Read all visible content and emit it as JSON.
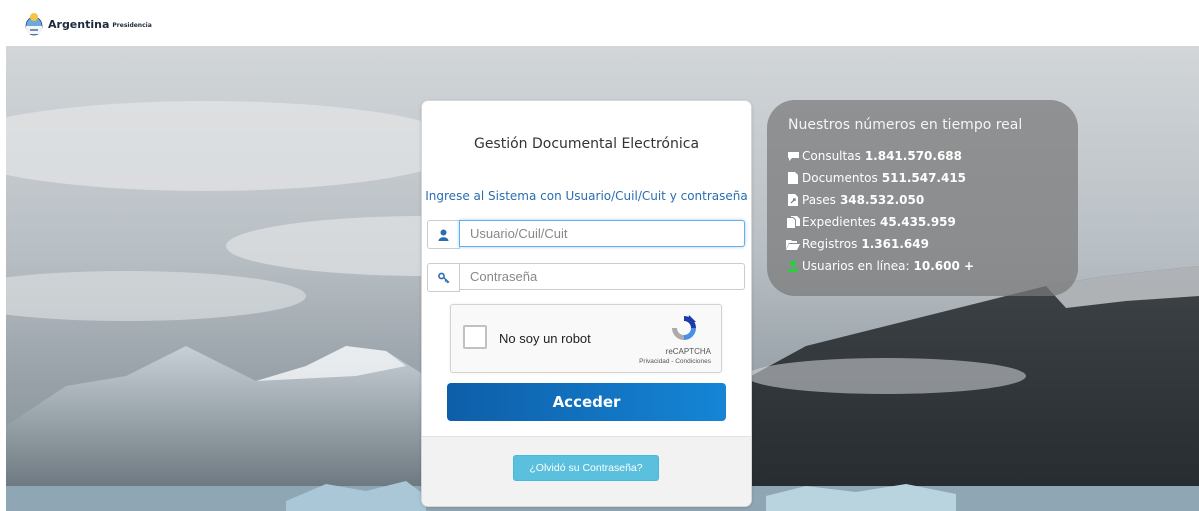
{
  "header": {
    "brand": "Argentina",
    "brand_sub": "Presidencia"
  },
  "login": {
    "title": "Gestión Documental Electrónica",
    "subtitle": "Ingrese al Sistema con Usuario/Cuil/Cuit y contraseña",
    "user_placeholder": "Usuario/Cuil/Cuit",
    "password_placeholder": "Contraseña",
    "user_icon": "user-icon",
    "password_icon": "key-icon",
    "captcha": {
      "label": "No soy un robot",
      "brand": "reCAPTCHA",
      "links": "Privacidad - Condiciones"
    },
    "submit_label": "Acceder",
    "forgot_label": "¿Olvidó su Contraseña?",
    "colors": {
      "primary": "#1176c6",
      "info": "#5bc0de"
    }
  },
  "stats": {
    "title": "Nuestros números en tiempo real",
    "items": [
      {
        "label": "Consultas",
        "value": "1.841.570.688",
        "icon": "comment-icon"
      },
      {
        "label": "Documentos",
        "value": "511.547.415",
        "icon": "document-icon"
      },
      {
        "label": "Pases",
        "value": "348.532.050",
        "icon": "share-icon"
      },
      {
        "label": "Expedientes",
        "value": "45.435.959",
        "icon": "files-icon"
      },
      {
        "label": "Registros",
        "value": "1.361.649",
        "icon": "folder-open-icon"
      },
      {
        "label": "Usuarios en línea:",
        "value": "10.600 +",
        "icon": "user-online-icon",
        "icon_color": "#2ecc40"
      }
    ]
  }
}
